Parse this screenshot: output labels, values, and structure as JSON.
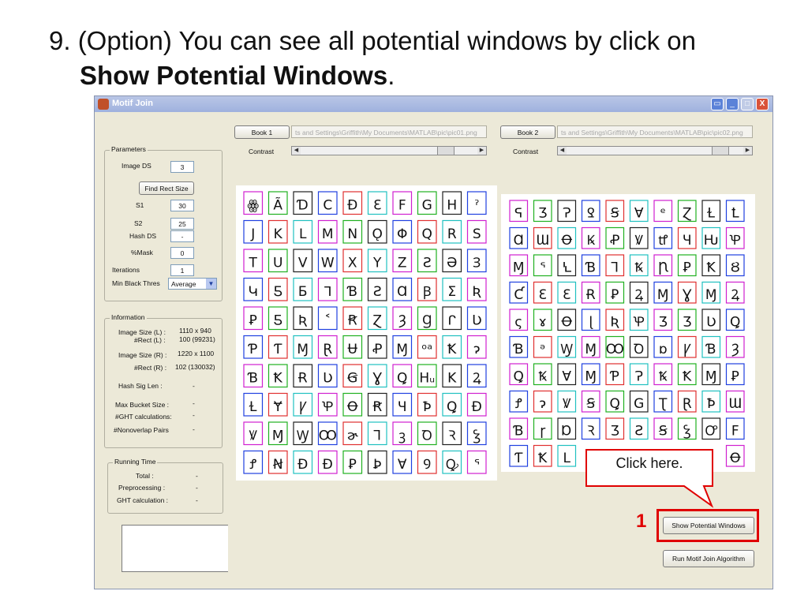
{
  "slide": {
    "title_line1": "9. (Option) You can see all potential windows by click on",
    "title_line2": "Show Potential Windows",
    "title_period": "."
  },
  "window": {
    "title": "Motif Join",
    "controls": {
      "restore": "▭",
      "minimize": "_",
      "maximize": "□",
      "close": "X"
    }
  },
  "book1": {
    "button": "Book 1",
    "path": "ts and Settings\\Griffith\\My Documents\\MATLAB\\pic\\pic01.png",
    "contrast_label": "Contrast",
    "contrast_level": 0.85
  },
  "book2": {
    "button": "Book 2",
    "path": "ts and Settings\\Griffith\\My Documents\\MATLAB\\pic\\pic02.png",
    "contrast_label": "Contrast",
    "contrast_level": 0.9
  },
  "parameters": {
    "legend": "Parameters",
    "image_ds_label": "Image DS",
    "image_ds_value": "3",
    "find_rect_button": "Find Rect Size",
    "s1_label": "S1",
    "s1_value": "30",
    "s2_label": "S2",
    "s2_value": "25",
    "hash_ds_label": "Hash DS",
    "hash_ds_value": "-",
    "mask_label": "%Mask",
    "mask_value": "0",
    "iterations_label": "Iterations",
    "iterations_value": "1",
    "min_black_label": "Min Black Thres",
    "min_black_value": "Average"
  },
  "information": {
    "legend": "Information",
    "image_size_l_label": "Image Size (L) :",
    "image_size_l_value": "1110 x 940",
    "rect_l_label": "#Rect (L) :",
    "rect_l_value": "100 (99231)",
    "image_size_r_label": "Image Size (R) :",
    "image_size_r_value": "1220 x 1100",
    "rect_r_label": "#Rect (R) :",
    "rect_r_value": "102 (130032)",
    "hash_sig_label": "Hash Sig Len :",
    "hash_sig_value": "-",
    "max_bucket_label": "Max Bucket Size :",
    "max_bucket_value": "-",
    "ght_calc_label": "#GHT calculations:",
    "ght_calc_value": "-",
    "nonoverlap_label": "#Nonoverlap Pairs",
    "nonoverlap_value": "-"
  },
  "running_time": {
    "legend": "Running Time",
    "total_label": "Total :",
    "total_value": "-",
    "preprocessing_label": "Preprocessing :",
    "preprocessing_value": "-",
    "ght_label": "GHT calculation :",
    "ght_value": "-"
  },
  "buttons": {
    "show_potential": "Show Potential Windows",
    "run_motif": "Run Motif Join Algorithm"
  },
  "annotation": {
    "callout_text": "Click here.",
    "step_number": "1",
    "highlight_color": "#e00000"
  },
  "left_glyphs": [
    [
      "ꙮ",
      "Ã",
      "Ɗ",
      "C",
      "Ɖ",
      "Ɛ",
      "F",
      "G",
      "H",
      "ˀ"
    ],
    [
      "J",
      "K",
      "L",
      "M",
      "N",
      "Ǫ",
      "Φ",
      "Q",
      "R",
      "S"
    ],
    [
      "T",
      "U",
      "V",
      "W",
      "X",
      "Y",
      "Z",
      "Ꙅ",
      "Ə",
      "Ɜ"
    ],
    [
      "Կ",
      "Ƽ",
      "Ƃ",
      "ᒣ",
      "Ɓ",
      "Ƨ",
      "Ɑ",
      "Ꞵ",
      "Σ",
      "Ʀ"
    ],
    [
      "Ꝑ",
      "Ƽ",
      "Ʀ",
      "˂",
      "Ꞧ",
      "Ɀ",
      "Ȝ",
      "Ɡ",
      "ᒋ",
      "Ʋ"
    ],
    [
      "Ƥ",
      "Ƭ",
      "Ɱ",
      "Ɽ",
      "Ʉ",
      "Ꝓ",
      "Ɱ",
      "ᵒᵃ",
      "Ꝁ",
      "ɂ"
    ],
    [
      "Ɓ",
      "Ꝁ",
      "Ɍ",
      "Ʋ",
      "Ꞡ",
      "Ɣ",
      "Ꝗ",
      "Hᵤ",
      "K",
      "Ꝝ"
    ],
    [
      "Ɫ",
      "Ɏ",
      "Ꝩ",
      "Ꝕ",
      "Ꝋ",
      "Ꞧ",
      "Ɥ",
      "Ꝥ",
      "Ꝗ",
      "Ɖ"
    ],
    [
      "Ꝟ",
      "Ɱ",
      "Ꝡ",
      "Ꝏ",
      "ɚ",
      "Ꞁ",
      "ꝫ",
      "Ꝺ",
      "Ꝛ",
      "Ꝣ"
    ],
    [
      "Ꝭ",
      "Ꞥ",
      "Ɖ",
      "Ɖ",
      "Ꝑ",
      "Ꝧ",
      "Ɐ",
      "Ꝯ",
      "Ꝙ",
      "ᕐ"
    ]
  ],
  "right_glyphs": [
    [
      "ᕋ",
      "Ʒ",
      "Ɂ",
      "Ꝿ",
      "Ꞩ",
      "Ɐ",
      "ᵉ",
      "Ɀ",
      "Ɫ",
      "Ꝉ"
    ],
    [
      "Ɑ",
      "Ɯ",
      "Ꝋ",
      "Ꝃ",
      "Ꝓ",
      "Ꝟ",
      "ꝷ",
      "Ɥ",
      "Ƕ",
      "Ꝕ"
    ],
    [
      "Ɱ",
      "ᕐ",
      "Ꝇ",
      "Ɓ",
      "Ꞁ",
      "Ꝅ",
      "Ꞃ",
      "Ꝑ",
      "Ꝁ",
      "Ȣ"
    ],
    [
      "Ƈ",
      "Ɛ",
      "Ɛ",
      "Ɍ",
      "Ꝑ",
      "Ꝝ",
      "Ɱ",
      "Ɣ",
      "Ɱ",
      "Ꝝ"
    ],
    [
      "ς",
      "ɤ",
      "Ꝋ",
      "ɭ",
      "Ʀ",
      "Ꝕ",
      "Ʒ",
      "Ʒ",
      "Ʋ",
      "Ꝗ"
    ],
    [
      "Ɓ",
      "ᵊ",
      "Ꝡ",
      "Ɱ",
      "Ꝏ",
      "Ꝺ",
      "ɒ",
      "Ꝩ",
      "Ɓ",
      "Ȝ"
    ],
    [
      "Ꝗ",
      "Ꝅ",
      "Ɐ",
      "Ɱ",
      "Ƥ",
      "Ɂ",
      "Ꝅ",
      "Ꝁ",
      "Ɱ",
      "Ꝑ"
    ],
    [
      "Ꝭ",
      "ɂ",
      "Ꝟ",
      "Ꞩ",
      "Ꝗ",
      "G",
      "Ʈ",
      "Ɽ",
      "Ꝥ",
      "Ɯ"
    ],
    [
      "Ɓ",
      "ɼ",
      "Ɒ",
      "Ꝛ",
      "Ʒ",
      "Ƨ",
      "Ꞩ",
      "Ꝣ",
      "Ꝍ",
      "F"
    ],
    [
      "Ƭ",
      "Ꝁ",
      "L",
      "",
      "",
      "",
      "",
      "",
      "",
      "Ꝋ"
    ]
  ],
  "frame_colors": [
    "#d020d0",
    "#20b020",
    "#202020",
    "#2040e0",
    "#e03030",
    "#20c0c0"
  ]
}
